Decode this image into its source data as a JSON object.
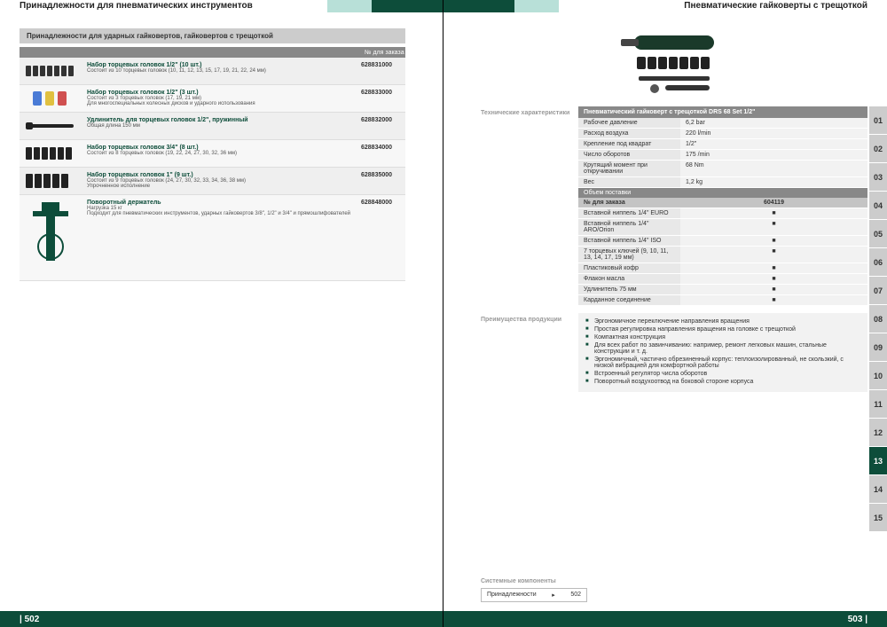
{
  "left": {
    "header_title": "Принадлежности для пневматических инструментов",
    "section_header": "Принадлежности для ударных гайковертов, гайковертов с трещоткой",
    "order_col_label": "№ для заказа",
    "page_number": "| 502",
    "items": [
      {
        "line1": "Набор торцевых головок 1/2\" (10 шт.)",
        "line2": "Состоит из 10 торцевых головок (10, 11, 12, 13, 15, 17, 19, 21, 22, 24 мм)",
        "line3": "",
        "order": "628831000"
      },
      {
        "line1": "Набор торцевых головок 1/2\" (3 шт.)",
        "line2": "Состоит из 3 торцевых головок (17, 19, 21 мм)",
        "line3": "Для многоспециальных колесных дисков и ударного использования",
        "order": "628833000"
      },
      {
        "line1": "Удлинитель для торцевых головок 1/2\", пружинный",
        "line2": "Общая длина 150 мм",
        "line3": "",
        "order": "628832000"
      },
      {
        "line1": "Набор торцевых головок 3/4\" (8 шт.)",
        "line2": "Состоит из 8 торцевых головок (19, 22, 24, 27, 30, 32, 36 мм)",
        "line3": "",
        "order": "628834000"
      },
      {
        "line1": "Набор торцевых головок 1\" (9 шт.)",
        "line2": "Состоит из 9 торцевых головок (24, 27, 30, 32, 33, 34, 36, 38 мм)",
        "line3": "Упрочненное исполнение",
        "order": "628835000"
      },
      {
        "line1": "Поворотный держатель",
        "line2": "Нагрузка 15 кг",
        "line3": "Подходит для пневматических инструментов, ударных гайковертов 3/8\", 1/2\" и 3/4\" и прямошлифователей",
        "order": "628848000"
      }
    ]
  },
  "right": {
    "header_title": "Пневматические гайковерты с трещоткой",
    "page_number": "503 |",
    "spec_section_label": "Технические характеристики",
    "product_title": "Пневматический гайковерт с трещоткой DRS 68 Set 1/2\"",
    "specs": [
      {
        "k": "Рабочее давление",
        "v": "6,2 bar"
      },
      {
        "k": "Расход воздуха",
        "v": "220 l/min"
      },
      {
        "k": "Крепление под квадрат",
        "v": "1/2\""
      },
      {
        "k": "Число оборотов",
        "v": "175 /min"
      },
      {
        "k": "Крутящий момент при откручивании",
        "v": "68 Nm"
      },
      {
        "k": "Вес",
        "v": "1,2 kg"
      }
    ],
    "scope_header": "Объем поставки",
    "scope_order_label": "№ для заказа",
    "scope_order_value": "604119",
    "scope_items": [
      "Вставной ниппель 1/4\" EURO",
      "Вставной ниппель 1/4\" ARO/Orion",
      "Вставной ниппель 1/4\" ISO",
      "7 торцевых ключей (9, 10, 11, 13, 14, 17, 19 мм)",
      "Пластиковый кофр",
      "Флакон масла",
      "Удлинитель 75 мм",
      "Карданное соединение"
    ],
    "scope_mark": "■",
    "adv_label": "Преимущества продукции",
    "advantages": [
      "Эргономичное переключение направления вращения",
      "Простая регулировка направления вращения на головке с трещоткой",
      "Компактная конструкция",
      "Для всех работ по завинчиванию: например, ремонт легковых машин, стальные конструкции и т. д.",
      "Эргономичный, частично обрезиненный корпус: теплоизолированный, не скользкий, с низкой вибрацией для комфортной работы",
      "Встроенный регулятор числа оборотов",
      "Поворотный воздухоотвод на боковой стороне корпуса"
    ],
    "sys_label": "Системные компоненты",
    "sys_link_text": "Принадлежности",
    "sys_link_page": "502",
    "tabs": [
      "01",
      "02",
      "03",
      "04",
      "05",
      "06",
      "07",
      "08",
      "09",
      "10",
      "11",
      "12",
      "13",
      "14",
      "15"
    ],
    "active_tab": "13"
  }
}
